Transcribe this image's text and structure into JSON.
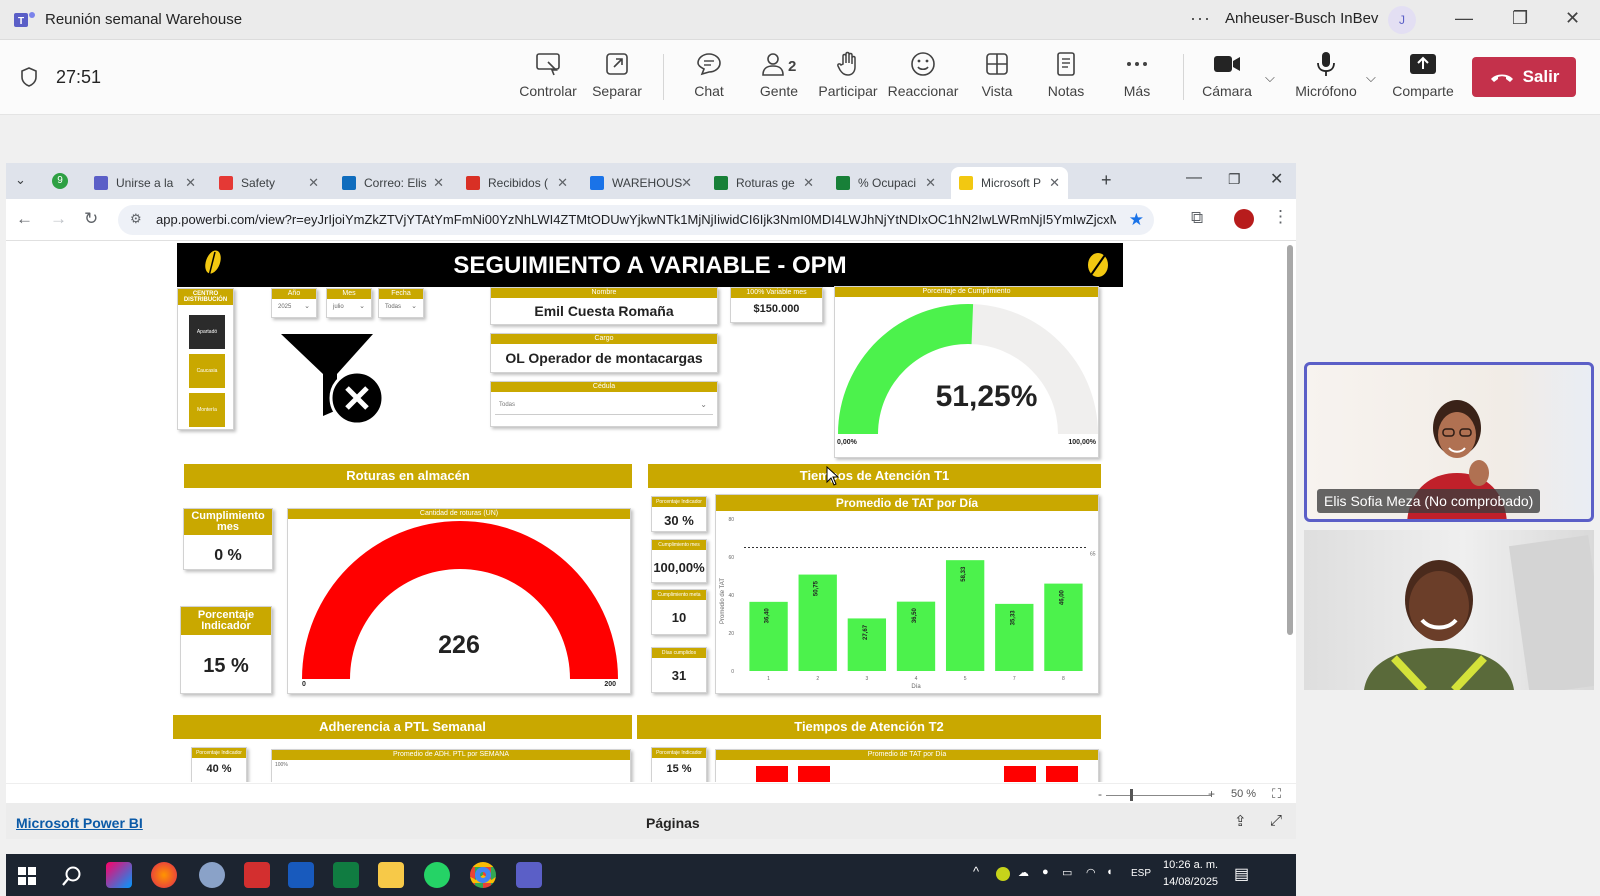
{
  "teams": {
    "window_title": "Reunión semanal Warehouse",
    "more": "···",
    "org": "Anheuser-Busch InBev",
    "avatar": "J",
    "timer": "27:51",
    "buttons": {
      "control": "Controlar",
      "popout": "Separar",
      "chat": "Chat",
      "people": "Gente",
      "people_count": "2",
      "raise": "Participar",
      "react": "Reaccionar",
      "view": "Vista",
      "notes": "Notas",
      "more": "Más",
      "camera": "Cámara",
      "mic": "Micrófono",
      "share": "Comparte",
      "leave": "Salir"
    }
  },
  "browser": {
    "tabs": [
      {
        "label": "Unirse a la",
        "icon_color": "#5b5fc7",
        "icon": "teams-icon"
      },
      {
        "label": "Safety",
        "icon_color": "#e53935",
        "icon": "safety-icon"
      },
      {
        "label": "Correo: Elis",
        "icon_color": "#0f6cbd",
        "icon": "outlook-icon"
      },
      {
        "label": "Recibidos (",
        "icon_color": "#d93025",
        "icon": "gmail-icon"
      },
      {
        "label": "WAREHOUS",
        "icon_color": "#1a73e8",
        "icon": "drive-icon"
      },
      {
        "label": "Roturas ge",
        "icon_color": "#188038",
        "icon": "sheets-icon"
      },
      {
        "label": "% Ocupaci",
        "icon_color": "#188038",
        "icon": "sheets-icon"
      },
      {
        "label": "Microsoft P",
        "icon_color": "#f2c811",
        "icon": "powerbi-icon"
      }
    ],
    "url": "app.powerbi.com/view?r=eyJrIjoiYmZkZTVjYTAtYmFmNi00YzNhLWI4ZTMtODUwYjkwNTk1MjNjIiwidCI6Ijk3NmI0MDI4LWJhNjYtNDIxOC1hN2IwLWRmNjI5YmIwZjcxM...",
    "zoom": "50 %",
    "footer_left": "Microsoft Power BI",
    "footer_center": "Páginas"
  },
  "report": {
    "title": "SEGUIMIENTO A VARIABLE - OPM",
    "filters": {
      "centro_label": "CENTRO DISTRIBUCIÓN",
      "centro_items": [
        "Apartadó",
        "Caucasia",
        "Montería"
      ],
      "anio_label": "Año",
      "anio_value": "2025",
      "mes_label": "Mes",
      "mes_value": "julio",
      "fecha_label": "Fecha",
      "fecha_value": "Todas"
    },
    "nombre_label": "Nombre",
    "nombre": "Emil Cuesta Romaña",
    "cargo_label": "Cargo",
    "cargo": "OL Operador de montacargas",
    "cedula_label": "Cédula",
    "cedula": "Todas",
    "variable_label": "100% Variable mes",
    "variable": "$150.000",
    "gauge1": {
      "label": "Porcentaje de Cumplimiento",
      "value_text": "51,25%",
      "value": 51.25,
      "min": "0,00%",
      "max": "100,00%"
    },
    "roturas": {
      "section": "Roturas en almacén",
      "cumplimiento_label": "Cumplimiento mes",
      "cumplimiento": "0 %",
      "porcentaje_label": "Porcentaje Indicador",
      "porcentaje": "15 %",
      "gauge_label": "Cantidad de roturas (UN)",
      "value": 226,
      "value_text": "226",
      "min": "0",
      "max": "200"
    },
    "t1": {
      "section": "Tiempos de Atención T1",
      "cards": [
        {
          "label": "Porcentaje Indicador",
          "value": "30 %"
        },
        {
          "label": "Cumplimiento mes",
          "value": "100,00%"
        },
        {
          "label": "Cumplimiento meta",
          "value": "10"
        },
        {
          "label": "Días cumplidos",
          "value": "31"
        }
      ],
      "chart_title": "Promedio de TAT por Día"
    },
    "t2_section": "Tiempos de Atención T2",
    "t2_card": "15 %",
    "t2_card_label": "Porcentaje Indicador",
    "t2_chart_title": "Promedio de TAT por Día",
    "ptl": {
      "section": "Adherencia a PTL Semanal",
      "card": "40 %",
      "card_label": "Porcentaje Indicador",
      "chart_title": "Promedio de ADH. PTL por SEMANA",
      "axis_top": "100%"
    }
  },
  "chart_data": {
    "type": "bar",
    "title": "Promedio de TAT por Día",
    "xlabel": "Día",
    "ylabel": "Promedio de TAT",
    "categories": [
      "1",
      "2",
      "3",
      "4",
      "5",
      "7",
      "8"
    ],
    "values": [
      36.4,
      50.75,
      27.67,
      36.5,
      58.33,
      35.33,
      46.0
    ],
    "value_labels": [
      "36,40",
      "50,75",
      "27,67",
      "36,50",
      "58,33",
      "35,33",
      "46,00"
    ],
    "yticks": [
      "0",
      "20",
      "40",
      "60",
      "80"
    ],
    "ylim": [
      0,
      80
    ],
    "target": 65,
    "target_label": "65",
    "color": "#4cf24c"
  },
  "participants": [
    {
      "name": "Elis Sofia Meza (No comprobado)"
    },
    {
      "name": ""
    }
  ],
  "taskbar": {
    "lang": "ESP",
    "time": "10:26 a. m.",
    "date": "14/08/2025"
  },
  "colors": {
    "gold": "#c9a800",
    "teams_purple": "#5b5fc7",
    "leave_red": "#c4314b",
    "gauge_green": "#4cf24c",
    "gauge_red": "#ff0000"
  }
}
